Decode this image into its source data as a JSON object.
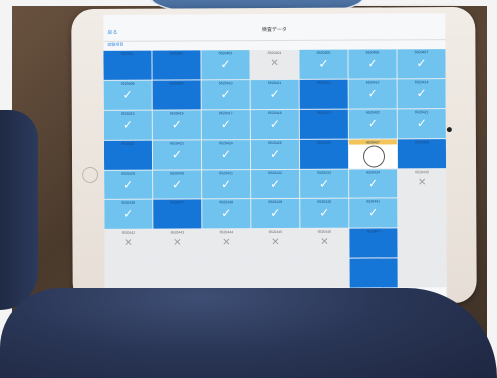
{
  "screen": {
    "nav_back": "戻る",
    "nav_title": "検査データ",
    "sub_label": "試験項目"
  },
  "grid": {
    "cells": [
      {
        "label": "6520401",
        "state": "dark",
        "mark": ""
      },
      {
        "label": "6520402",
        "state": "dark",
        "mark": ""
      },
      {
        "label": "6520403",
        "state": "light",
        "mark": "✓"
      },
      {
        "label": "6520404",
        "state": "grey",
        "mark": "✕"
      },
      {
        "label": "6520405",
        "state": "light",
        "mark": "✓"
      },
      {
        "label": "6520406",
        "state": "light",
        "mark": "✓"
      },
      {
        "label": "6520407",
        "state": "light",
        "mark": "✓"
      },
      {
        "label": "6520408",
        "state": "light",
        "mark": "✓"
      },
      {
        "label": "6520409",
        "state": "dark",
        "mark": ""
      },
      {
        "label": "6520410",
        "state": "light",
        "mark": "✓"
      },
      {
        "label": "6520411",
        "state": "light",
        "mark": "✓"
      },
      {
        "label": "6520412",
        "state": "dark",
        "mark": ""
      },
      {
        "label": "6520413",
        "state": "light",
        "mark": "✓"
      },
      {
        "label": "6520414",
        "state": "light",
        "mark": "✓"
      },
      {
        "label": "6520415",
        "state": "light",
        "mark": "✓"
      },
      {
        "label": "6520416",
        "state": "light",
        "mark": "✓"
      },
      {
        "label": "6520417",
        "state": "light",
        "mark": "✓"
      },
      {
        "label": "6520418",
        "state": "light",
        "mark": "✓"
      },
      {
        "label": "6520419",
        "state": "dark",
        "mark": ""
      },
      {
        "label": "6520420",
        "state": "light",
        "mark": "✓"
      },
      {
        "label": "6520421",
        "state": "light",
        "mark": "✓"
      },
      {
        "label": "6520422",
        "state": "dark",
        "mark": ""
      },
      {
        "label": "6520423",
        "state": "light",
        "mark": "✓"
      },
      {
        "label": "6520424",
        "state": "light",
        "mark": "✓"
      },
      {
        "label": "6520425",
        "state": "light",
        "mark": "✓"
      },
      {
        "label": "6520426",
        "state": "dark",
        "mark": ""
      },
      {
        "label": "6520427",
        "state": "yellow",
        "mark": ""
      },
      {
        "label": "6520428",
        "state": "dark",
        "mark": ""
      },
      {
        "label": "6520429",
        "state": "light",
        "mark": "✓"
      },
      {
        "label": "6520430",
        "state": "light",
        "mark": "✓"
      },
      {
        "label": "6520431",
        "state": "light",
        "mark": "✓"
      },
      {
        "label": "6520432",
        "state": "light",
        "mark": "✓"
      },
      {
        "label": "6520433",
        "state": "light",
        "mark": "✓"
      },
      {
        "label": "6520434",
        "state": "light",
        "mark": "✓"
      },
      {
        "label": "6520435",
        "state": "grey",
        "mark": "✕"
      },
      {
        "label": "6520436",
        "state": "light",
        "mark": "✓"
      },
      {
        "label": "6520437",
        "state": "dark",
        "mark": ""
      },
      {
        "label": "6520438",
        "state": "light",
        "mark": "✓"
      },
      {
        "label": "6520439",
        "state": "light",
        "mark": "✓"
      },
      {
        "label": "6520440",
        "state": "light",
        "mark": "✓"
      },
      {
        "label": "6520441",
        "state": "light",
        "mark": "✓"
      },
      {
        "label": "",
        "state": "grey",
        "mark": ""
      },
      {
        "label": "6520442",
        "state": "grey",
        "mark": "✕"
      },
      {
        "label": "6520443",
        "state": "grey",
        "mark": "✕"
      },
      {
        "label": "6520444",
        "state": "grey",
        "mark": "✕"
      },
      {
        "label": "6520445",
        "state": "grey",
        "mark": "✕"
      },
      {
        "label": "6520446",
        "state": "grey",
        "mark": "✕"
      },
      {
        "label": "6520447",
        "state": "dark",
        "mark": ""
      },
      {
        "label": "",
        "state": "grey",
        "mark": ""
      },
      {
        "label": "",
        "state": "grey",
        "mark": ""
      },
      {
        "label": "",
        "state": "grey",
        "mark": ""
      },
      {
        "label": "",
        "state": "grey",
        "mark": ""
      },
      {
        "label": "",
        "state": "grey",
        "mark": ""
      },
      {
        "label": "",
        "state": "grey",
        "mark": ""
      },
      {
        "label": "",
        "state": "dark",
        "mark": ""
      },
      {
        "label": "",
        "state": "grey",
        "mark": ""
      }
    ]
  },
  "colors": {
    "cell_light": "#6fc3ee",
    "cell_dark": "#1676d8",
    "cell_grey": "#e9eaec",
    "highlight": "#f2c45a"
  }
}
